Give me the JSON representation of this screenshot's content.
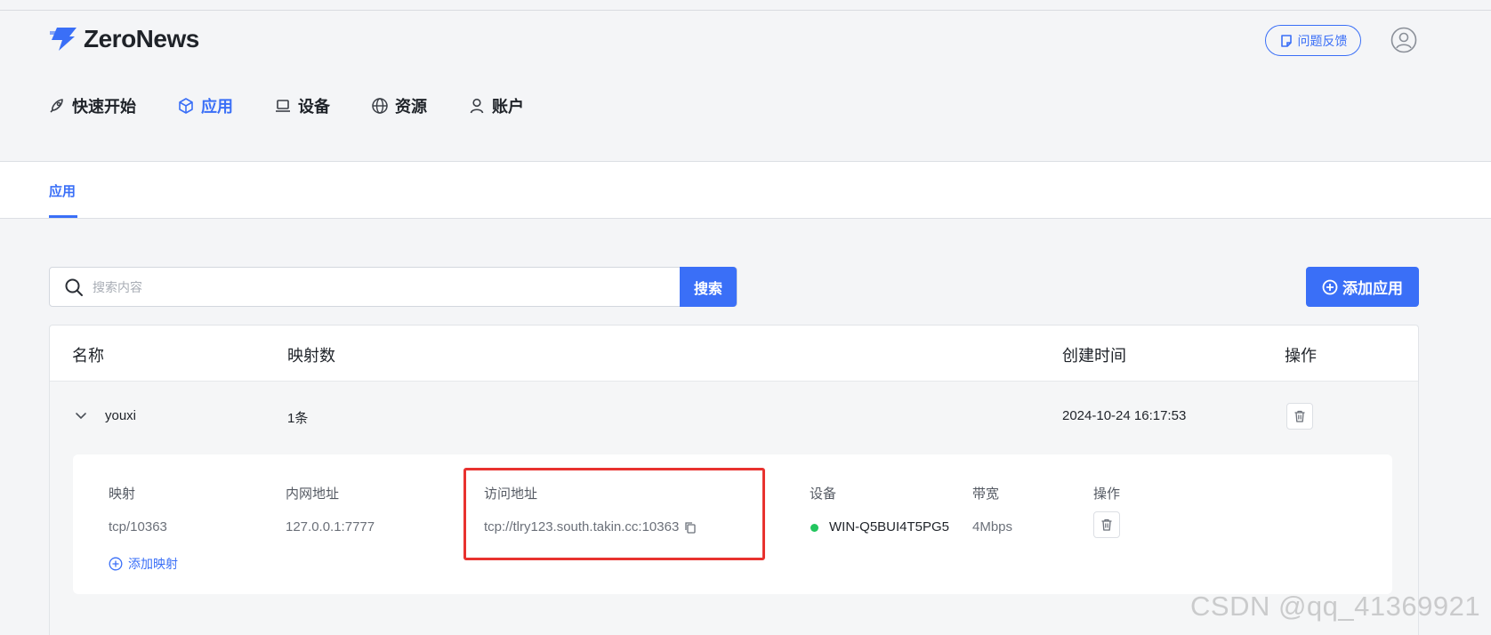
{
  "header": {
    "brand": "ZeroNews",
    "feedback_label": "问题反馈"
  },
  "nav": [
    {
      "label": "快速开始",
      "icon": "rocket-icon"
    },
    {
      "label": "应用",
      "icon": "cube-icon",
      "active": true
    },
    {
      "label": "设备",
      "icon": "laptop-icon"
    },
    {
      "label": "资源",
      "icon": "globe-icon"
    },
    {
      "label": "账户",
      "icon": "user-icon"
    }
  ],
  "subtab": {
    "label": "应用"
  },
  "search": {
    "placeholder": "搜索内容",
    "button_label": "搜索"
  },
  "add_app_label": "添加应用",
  "table": {
    "headers": [
      "名称",
      "映射数",
      "创建时间",
      "操作"
    ],
    "rows": [
      {
        "name": "youxi",
        "mapping_count": "1条",
        "created_at": "2024-10-24 16:17:53",
        "mappings": {
          "headers": [
            "映射",
            "内网地址",
            "访问地址",
            "设备",
            "带宽",
            "操作"
          ],
          "items": [
            {
              "mapping": "tcp/10363",
              "internal": "127.0.0.1:7777",
              "access": "tcp://tlry123.south.takin.cc:10363",
              "device": "WIN-Q5BUI4T5PG5",
              "device_status": "online",
              "bandwidth": "4Mbps"
            }
          ],
          "add_label": "添加映射"
        }
      }
    ]
  },
  "colors": {
    "accent": "#3a6ff7",
    "highlight": "#e8322f",
    "online": "#22c55e"
  },
  "watermark": "CSDN @qq_41369921"
}
